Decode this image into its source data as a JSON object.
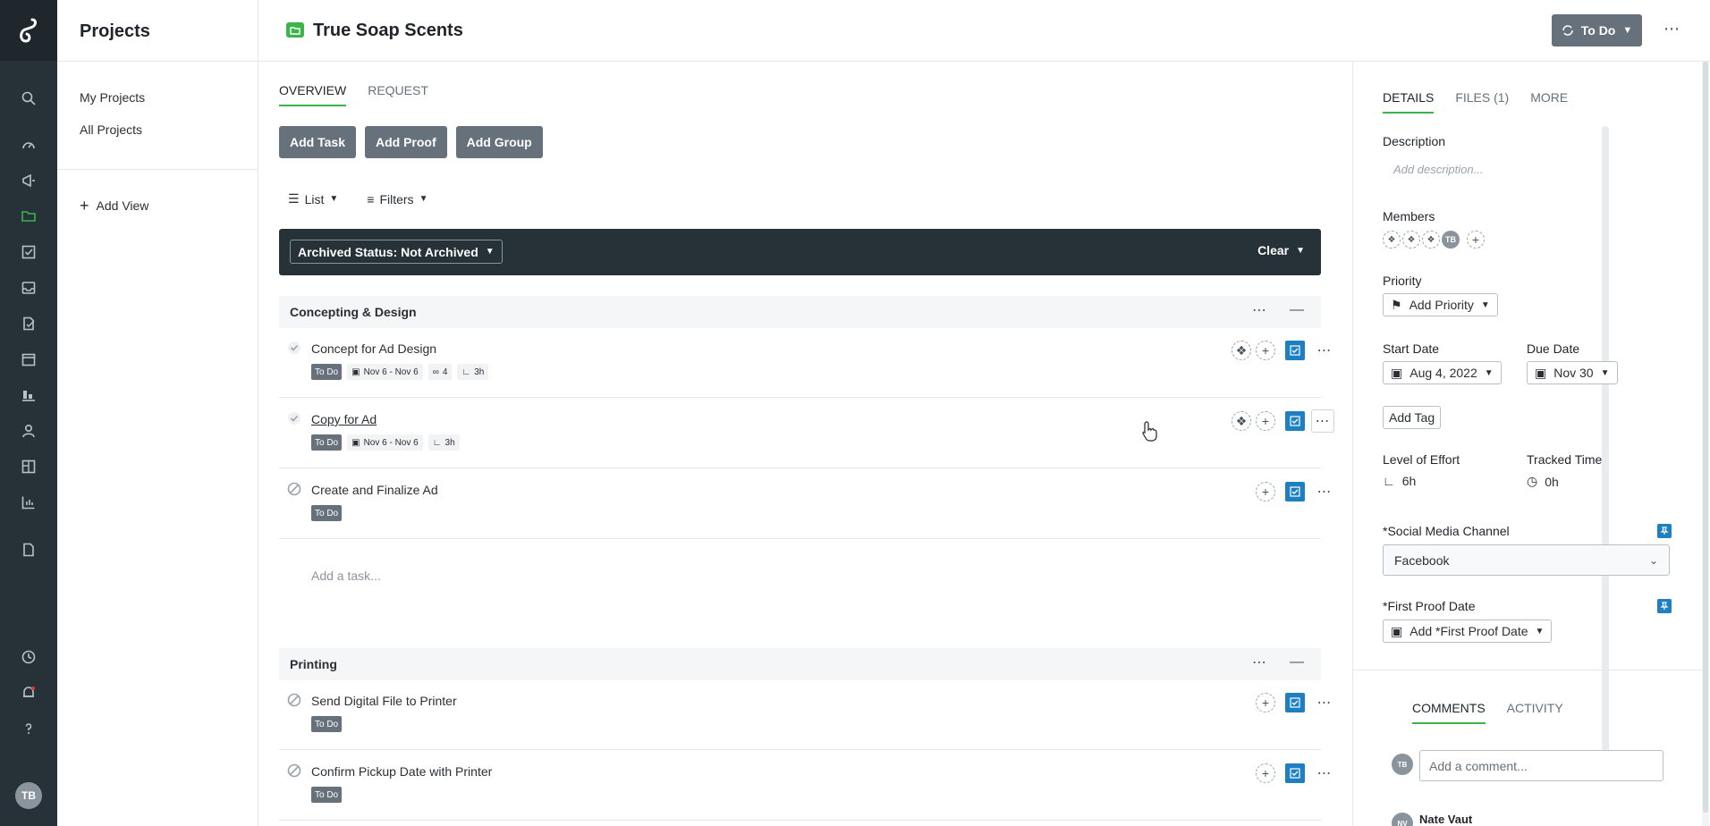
{
  "app": {
    "colors": {
      "rail": "#263238",
      "accent": "#3bb54a",
      "button": "#66717b",
      "blue": "#1e7fc1"
    }
  },
  "rail": {
    "user_initials": "TB"
  },
  "subnav": {
    "title": "Projects",
    "links": [
      "My Projects",
      "All Projects"
    ],
    "add_view": "Add View"
  },
  "header": {
    "title": "True Soap Scents",
    "status": "To Do"
  },
  "main": {
    "tabs": [
      "OVERVIEW",
      "REQUEST"
    ],
    "buttons": [
      "Add Task",
      "Add Proof",
      "Add Group"
    ],
    "view": "List",
    "filters": "Filters",
    "filter_chip": "Archived Status: Not Archived",
    "clear": "Clear",
    "add_task_placeholder": "Add a task..."
  },
  "groups": [
    {
      "name": "Concepting & Design",
      "tasks": [
        {
          "name": "Concept for Ad Design",
          "status": "To Do",
          "dates": "Nov 6 - Nov 6",
          "links": "4",
          "effort": "3h"
        },
        {
          "name": "Copy for Ad",
          "status": "To Do",
          "dates": "Nov 6 - Nov 6",
          "effort": "3h"
        },
        {
          "name": "Create and Finalize Ad",
          "status": "To Do"
        }
      ]
    },
    {
      "name": "Printing",
      "tasks": [
        {
          "name": "Send Digital File to Printer",
          "status": "To Do"
        },
        {
          "name": "Confirm Pickup Date with Printer",
          "status": "To Do"
        }
      ]
    }
  ],
  "panel": {
    "tabs": [
      "DETAILS",
      "FILES (1)",
      "MORE"
    ],
    "description_label": "Description",
    "description_placeholder": "Add description...",
    "members_label": "Members",
    "member_initials": "TB",
    "priority_label": "Priority",
    "priority_value": "Add Priority",
    "start_date_label": "Start Date",
    "start_date": "Aug 4, 2022",
    "due_date_label": "Due Date",
    "due_date": "Nov 30",
    "add_tag": "Add Tag",
    "effort_label": "Level of Effort",
    "effort_value": "6h",
    "tracked_label": "Tracked Time",
    "tracked_value": "0h",
    "social_label": "*Social Media Channel",
    "social_value": "Facebook",
    "proof_label": "*First Proof Date",
    "proof_value": "Add *First Proof Date",
    "comment_tabs": [
      "COMMENTS",
      "ACTIVITY"
    ],
    "comment_placeholder": "Add a comment...",
    "commenter_initials": "TB",
    "comment_author": "Nate Vaut",
    "comment_author_initials": "NV"
  }
}
